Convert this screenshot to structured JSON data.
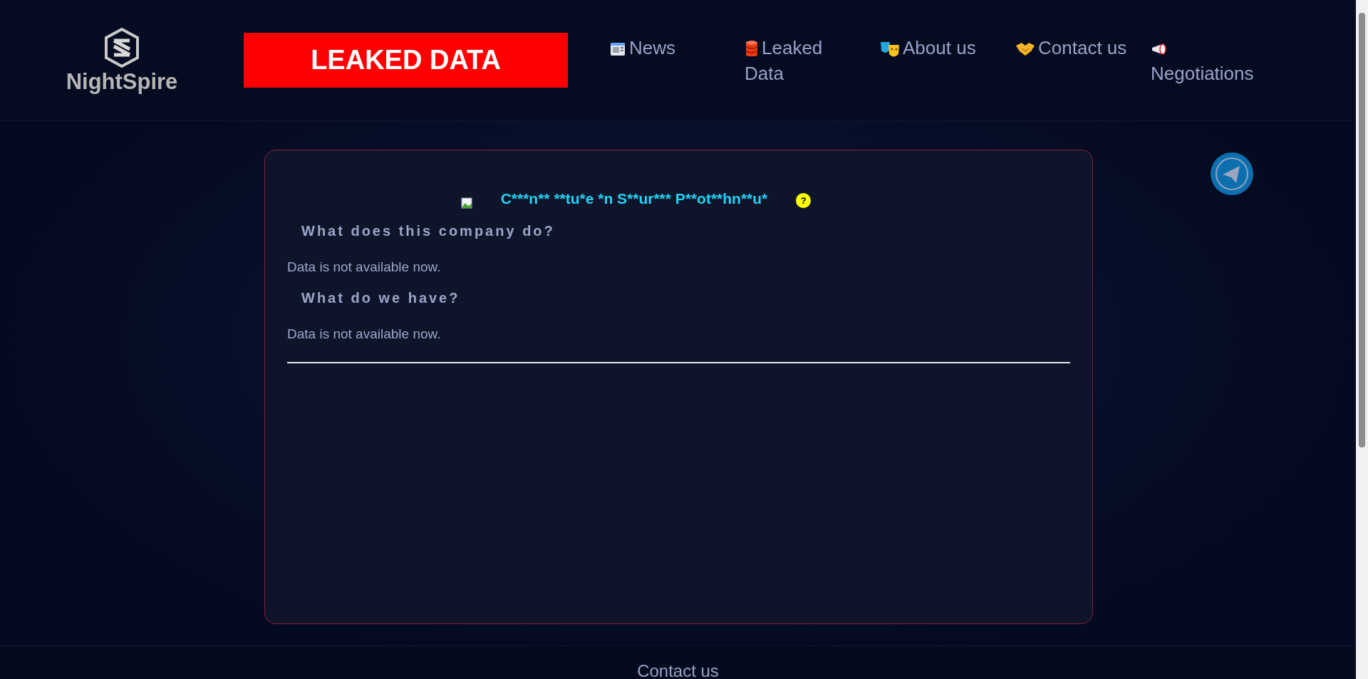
{
  "header": {
    "logo_text": "NightSpire",
    "banner": "LEAKED DATA",
    "nav": [
      {
        "kind": "news",
        "label": "News"
      },
      {
        "kind": "database",
        "label": "Leaked Data"
      },
      {
        "kind": "masks",
        "label": "About us"
      },
      {
        "kind": "handshake",
        "label": "Contact us"
      },
      {
        "kind": "megaphone",
        "label": "Negotiations"
      }
    ]
  },
  "card": {
    "title": "C***n** **tu*e *n S**ur*** P**ot**hn**u*",
    "help_badge": "?",
    "sections": [
      {
        "heading": "What does this company do?",
        "text": "Data is not available now."
      },
      {
        "heading": "What do we have?",
        "text": "Data is not available now."
      }
    ]
  },
  "footer": {
    "link": "Contact us"
  }
}
